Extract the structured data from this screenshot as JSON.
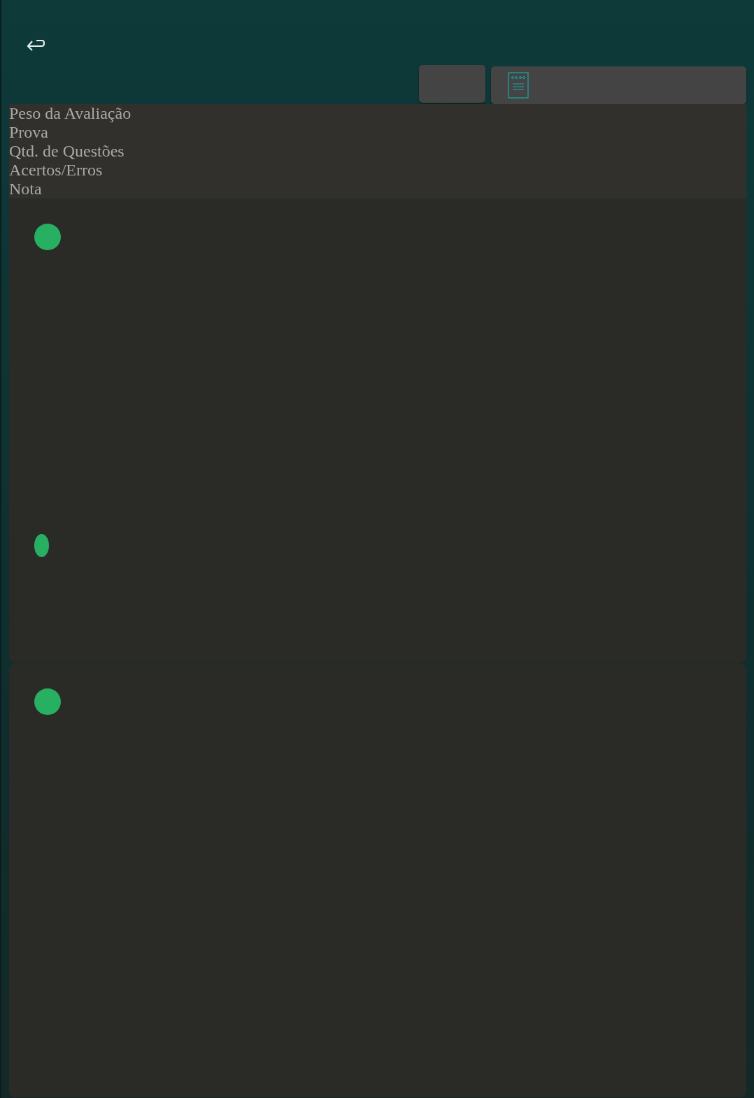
{
  "header": {
    "buttons": [
      {
        "kind": "back"
      }
    ]
  },
  "toolbar": {
    "buttons": [
      {
        "kind": "blank"
      },
      {
        "kind": "document"
      }
    ]
  },
  "table_header": {
    "columns": [
      "Peso da Avaliação",
      "Prova",
      "Qtd. de Questões",
      "Acertos/Erros",
      "Nota"
    ]
  },
  "cards": [
    {
      "markers": [
        {
          "kind": "dot"
        },
        {
          "kind": "oval"
        }
      ]
    },
    {
      "markers": [
        {
          "kind": "dot"
        }
      ]
    }
  ]
}
